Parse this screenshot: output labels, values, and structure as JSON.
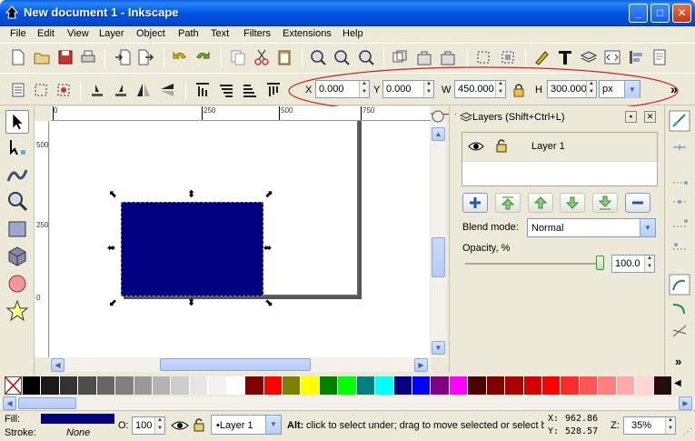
{
  "window": {
    "title": "New document 1 - Inkscape",
    "min": "_",
    "max": "□",
    "close": "✕"
  },
  "menu": [
    "File",
    "Edit",
    "View",
    "Layer",
    "Object",
    "Path",
    "Text",
    "Filters",
    "Extensions",
    "Help"
  ],
  "toolbar": {
    "x_label": "X",
    "x_value": "0.000",
    "y_label": "Y",
    "y_value": "0.000",
    "w_label": "W",
    "w_value": "450.000",
    "h_label": "H",
    "h_value": "300.000",
    "unit": "px",
    "overflow": "»"
  },
  "ruler": {
    "h_labels": [
      "0",
      "250",
      "500",
      "750"
    ],
    "v_labels": [
      "500",
      "250",
      "0"
    ]
  },
  "layers_panel": {
    "title": "Layers (Shift+Ctrl+L)",
    "layer_name": "Layer 1",
    "blend_label": "Blend mode:",
    "blend_value": "Normal",
    "opacity_label": "Opacity, %",
    "opacity_value": "100.0"
  },
  "palette": {
    "colors": [
      "#000000",
      "#1a1a1a",
      "#333333",
      "#4d4d4d",
      "#666666",
      "#808080",
      "#999999",
      "#b3b3b3",
      "#cccccc",
      "#e6e6e6",
      "#f2f2f2",
      "#ffffff",
      "#800000",
      "#ff0000",
      "#808000",
      "#ffff00",
      "#008000",
      "#00ff00",
      "#008080",
      "#00ffff",
      "#000080",
      "#0000ff",
      "#800080",
      "#ff00ff",
      "#4d0000",
      "#800000",
      "#aa0000",
      "#d40000",
      "#ff0000",
      "#ff2a2a",
      "#ff5555",
      "#ff8080",
      "#ffaaaa",
      "#ffd5d5",
      "#280b0b"
    ]
  },
  "status": {
    "fill_label": "Fill:",
    "stroke_label": "Stroke:",
    "stroke_value": "None",
    "fill_color": "#000080",
    "opacity_label": "O:",
    "opacity_value": "100",
    "layer_value": "•Layer 1",
    "message_bold": "Alt:",
    "message": " click to select under; drag to move selected or select b",
    "x_label": "X:",
    "x_value": "962.86",
    "y_label": "Y:",
    "y_value": "528.57",
    "zoom_label": "Z:",
    "zoom_value": "35%"
  }
}
